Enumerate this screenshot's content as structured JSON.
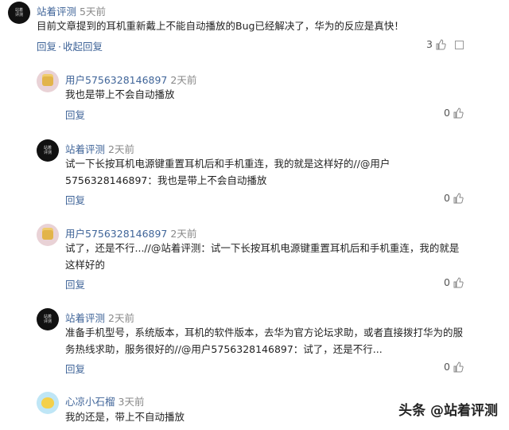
{
  "comments": [
    {
      "author": "站着评测",
      "time": "5天前",
      "text": "目前文章提到的耳机重新戴上不能自动播放的Bug已经解决了，华为的反应是真快！",
      "reply_label": "回复",
      "collapse_label": "收起回复",
      "likes": "3",
      "avatar_text": "站着\n评测"
    },
    {
      "author": "用户5756328146897",
      "time": "2天前",
      "text": "我也是带上不会自动播放",
      "reply_label": "回复",
      "likes": "0"
    },
    {
      "author": "站着评测",
      "time": "2天前",
      "text": "试一下长按耳机电源键重置耳机后和手机重连，我的就是这样好的//@用户5756328146897：我也是带上不会自动播放",
      "reply_label": "回复",
      "likes": "0",
      "avatar_text": "站着\n评测"
    },
    {
      "author": "用户5756328146897",
      "time": "2天前",
      "text": "试了，还是不行...//@站着评测：试一下长按耳机电源键重置耳机后和手机重连，我的就是这样好的",
      "reply_label": "回复",
      "likes": "0"
    },
    {
      "author": "站着评测",
      "time": "2天前",
      "text": "准备手机型号，系统版本，耳机的软件版本，去华为官方论坛求助，或者直接拨打华为的服务热线求助，服务很好的//@用户5756328146897：试了，还是不行...",
      "reply_label": "回复",
      "likes": "0",
      "avatar_text": "站着\n评测"
    },
    {
      "author": "心凉小石榴",
      "time": "3天前",
      "text": "我的还是，带上不自动播放"
    }
  ],
  "watermark": "头条 @站着评测",
  "colors": {
    "link": "#406599",
    "text": "#222222",
    "muted": "#888888"
  },
  "icons": [
    "thumbs-up-icon",
    "menu-icon"
  ]
}
